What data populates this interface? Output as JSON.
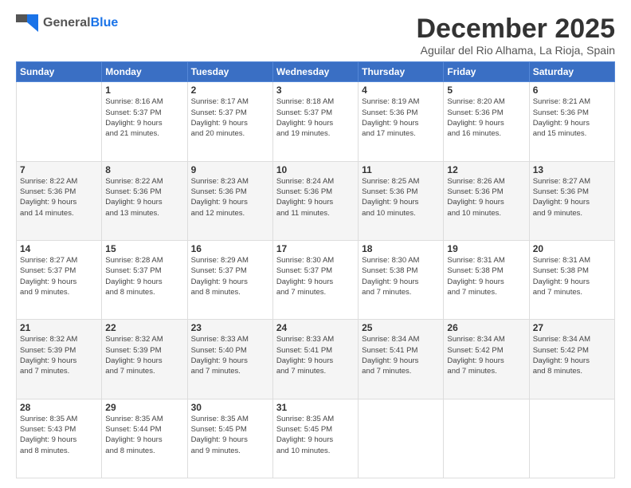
{
  "logo": {
    "general": "General",
    "blue": "Blue"
  },
  "header": {
    "month": "December 2025",
    "location": "Aguilar del Rio Alhama, La Rioja, Spain"
  },
  "weekdays": [
    "Sunday",
    "Monday",
    "Tuesday",
    "Wednesday",
    "Thursday",
    "Friday",
    "Saturday"
  ],
  "weeks": [
    [
      {
        "day": "",
        "info": ""
      },
      {
        "day": "1",
        "info": "Sunrise: 8:16 AM\nSunset: 5:37 PM\nDaylight: 9 hours\nand 21 minutes."
      },
      {
        "day": "2",
        "info": "Sunrise: 8:17 AM\nSunset: 5:37 PM\nDaylight: 9 hours\nand 20 minutes."
      },
      {
        "day": "3",
        "info": "Sunrise: 8:18 AM\nSunset: 5:37 PM\nDaylight: 9 hours\nand 19 minutes."
      },
      {
        "day": "4",
        "info": "Sunrise: 8:19 AM\nSunset: 5:36 PM\nDaylight: 9 hours\nand 17 minutes."
      },
      {
        "day": "5",
        "info": "Sunrise: 8:20 AM\nSunset: 5:36 PM\nDaylight: 9 hours\nand 16 minutes."
      },
      {
        "day": "6",
        "info": "Sunrise: 8:21 AM\nSunset: 5:36 PM\nDaylight: 9 hours\nand 15 minutes."
      }
    ],
    [
      {
        "day": "7",
        "info": "Sunrise: 8:22 AM\nSunset: 5:36 PM\nDaylight: 9 hours\nand 14 minutes."
      },
      {
        "day": "8",
        "info": "Sunrise: 8:22 AM\nSunset: 5:36 PM\nDaylight: 9 hours\nand 13 minutes."
      },
      {
        "day": "9",
        "info": "Sunrise: 8:23 AM\nSunset: 5:36 PM\nDaylight: 9 hours\nand 12 minutes."
      },
      {
        "day": "10",
        "info": "Sunrise: 8:24 AM\nSunset: 5:36 PM\nDaylight: 9 hours\nand 11 minutes."
      },
      {
        "day": "11",
        "info": "Sunrise: 8:25 AM\nSunset: 5:36 PM\nDaylight: 9 hours\nand 10 minutes."
      },
      {
        "day": "12",
        "info": "Sunrise: 8:26 AM\nSunset: 5:36 PM\nDaylight: 9 hours\nand 10 minutes."
      },
      {
        "day": "13",
        "info": "Sunrise: 8:27 AM\nSunset: 5:36 PM\nDaylight: 9 hours\nand 9 minutes."
      }
    ],
    [
      {
        "day": "14",
        "info": "Sunrise: 8:27 AM\nSunset: 5:37 PM\nDaylight: 9 hours\nand 9 minutes."
      },
      {
        "day": "15",
        "info": "Sunrise: 8:28 AM\nSunset: 5:37 PM\nDaylight: 9 hours\nand 8 minutes."
      },
      {
        "day": "16",
        "info": "Sunrise: 8:29 AM\nSunset: 5:37 PM\nDaylight: 9 hours\nand 8 minutes."
      },
      {
        "day": "17",
        "info": "Sunrise: 8:30 AM\nSunset: 5:37 PM\nDaylight: 9 hours\nand 7 minutes."
      },
      {
        "day": "18",
        "info": "Sunrise: 8:30 AM\nSunset: 5:38 PM\nDaylight: 9 hours\nand 7 minutes."
      },
      {
        "day": "19",
        "info": "Sunrise: 8:31 AM\nSunset: 5:38 PM\nDaylight: 9 hours\nand 7 minutes."
      },
      {
        "day": "20",
        "info": "Sunrise: 8:31 AM\nSunset: 5:38 PM\nDaylight: 9 hours\nand 7 minutes."
      }
    ],
    [
      {
        "day": "21",
        "info": "Sunrise: 8:32 AM\nSunset: 5:39 PM\nDaylight: 9 hours\nand 7 minutes."
      },
      {
        "day": "22",
        "info": "Sunrise: 8:32 AM\nSunset: 5:39 PM\nDaylight: 9 hours\nand 7 minutes."
      },
      {
        "day": "23",
        "info": "Sunrise: 8:33 AM\nSunset: 5:40 PM\nDaylight: 9 hours\nand 7 minutes."
      },
      {
        "day": "24",
        "info": "Sunrise: 8:33 AM\nSunset: 5:41 PM\nDaylight: 9 hours\nand 7 minutes."
      },
      {
        "day": "25",
        "info": "Sunrise: 8:34 AM\nSunset: 5:41 PM\nDaylight: 9 hours\nand 7 minutes."
      },
      {
        "day": "26",
        "info": "Sunrise: 8:34 AM\nSunset: 5:42 PM\nDaylight: 9 hours\nand 7 minutes."
      },
      {
        "day": "27",
        "info": "Sunrise: 8:34 AM\nSunset: 5:42 PM\nDaylight: 9 hours\nand 8 minutes."
      }
    ],
    [
      {
        "day": "28",
        "info": "Sunrise: 8:35 AM\nSunset: 5:43 PM\nDaylight: 9 hours\nand 8 minutes."
      },
      {
        "day": "29",
        "info": "Sunrise: 8:35 AM\nSunset: 5:44 PM\nDaylight: 9 hours\nand 8 minutes."
      },
      {
        "day": "30",
        "info": "Sunrise: 8:35 AM\nSunset: 5:45 PM\nDaylight: 9 hours\nand 9 minutes."
      },
      {
        "day": "31",
        "info": "Sunrise: 8:35 AM\nSunset: 5:45 PM\nDaylight: 9 hours\nand 10 minutes."
      },
      {
        "day": "",
        "info": ""
      },
      {
        "day": "",
        "info": ""
      },
      {
        "day": "",
        "info": ""
      }
    ]
  ]
}
